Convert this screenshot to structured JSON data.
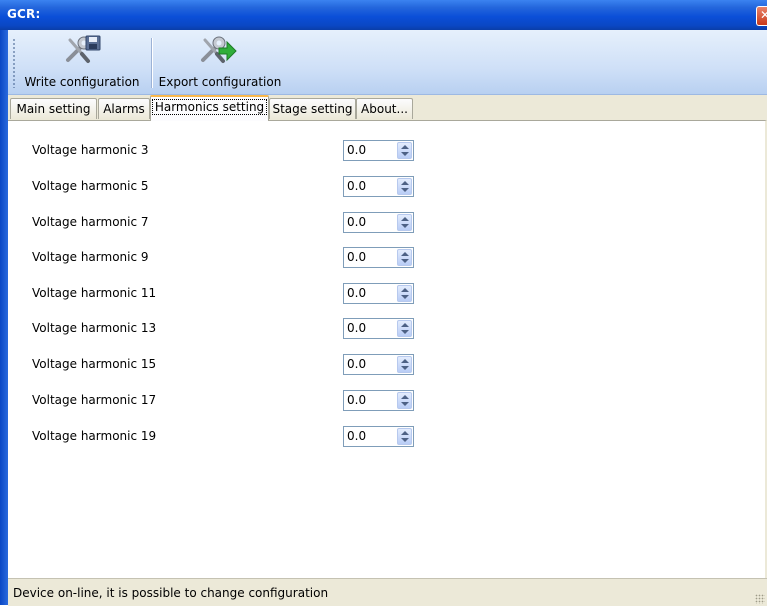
{
  "window": {
    "title": "GCR:"
  },
  "toolbar": {
    "buttons": [
      {
        "label": "Write configuration",
        "icon": "wrench-screwdriver-disk-icon"
      },
      {
        "label": "Export configuration",
        "icon": "wrench-screwdriver-green-arrow-icon"
      }
    ]
  },
  "tabs": [
    {
      "label": "Main setting",
      "active": false
    },
    {
      "label": "Alarms",
      "active": false
    },
    {
      "label": "Harmonics setting",
      "active": true
    },
    {
      "label": "Stage setting",
      "active": false
    },
    {
      "label": "About...",
      "active": false
    }
  ],
  "harmonics": [
    {
      "label": "Voltage harmonic 3",
      "value": "0.0"
    },
    {
      "label": "Voltage harmonic 5",
      "value": "0.0"
    },
    {
      "label": "Voltage harmonic 7",
      "value": "0.0"
    },
    {
      "label": "Voltage harmonic 9",
      "value": "0.0"
    },
    {
      "label": "Voltage harmonic 11",
      "value": "0.0"
    },
    {
      "label": "Voltage harmonic 13",
      "value": "0.0"
    },
    {
      "label": "Voltage harmonic 15",
      "value": "0.0"
    },
    {
      "label": "Voltage harmonic 17",
      "value": "0.0"
    },
    {
      "label": "Voltage harmonic 19",
      "value": "0.0"
    }
  ],
  "status": {
    "text": "Device on-line, it is possible to change configuration"
  },
  "colors": {
    "titlebar": "#0a47c4",
    "toolbar": "#cfe0f7",
    "active_tab_accent": "#f9b84d",
    "statusbar": "#ece9d8"
  }
}
